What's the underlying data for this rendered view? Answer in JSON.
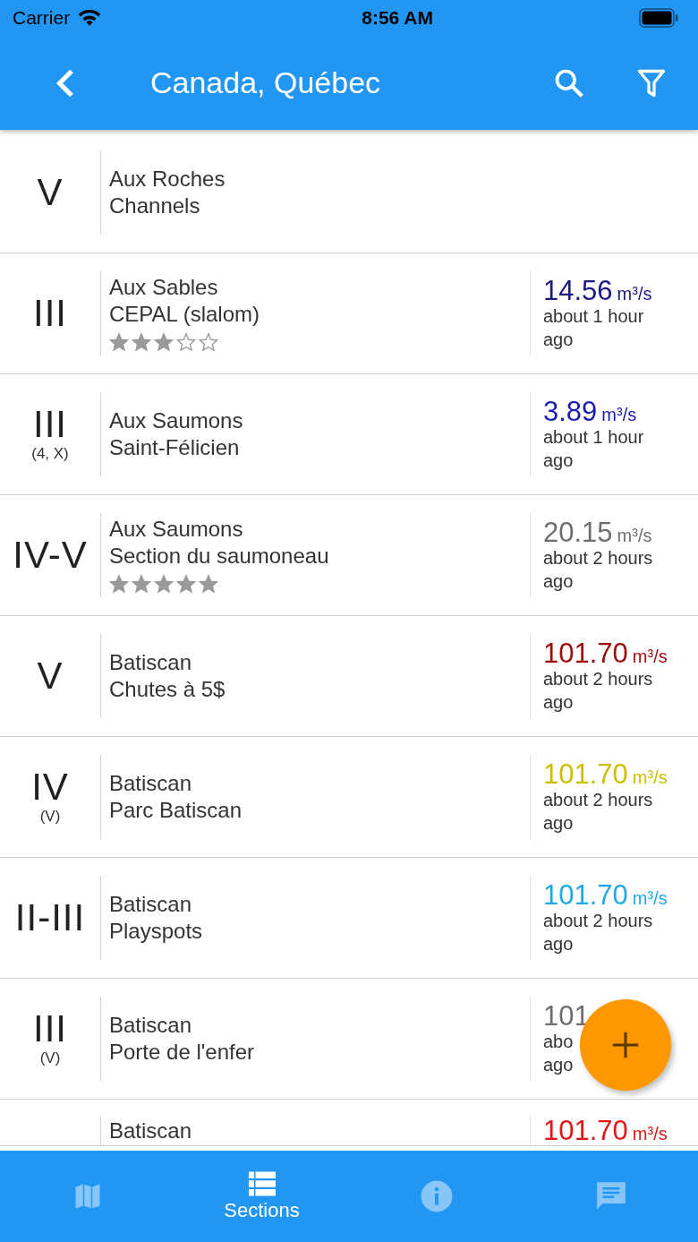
{
  "status_bar": {
    "carrier": "Carrier",
    "time": "8:56 AM"
  },
  "app_bar": {
    "title": "Canada, Québec"
  },
  "sections": [
    {
      "grade": "V",
      "river": "Aux Roches",
      "section": "Channels"
    },
    {
      "grade": "III",
      "river": "Aux Sables",
      "section": "CEPAL (slalom)",
      "stars": 3,
      "flow": "14.56",
      "unit": "m³/s",
      "color": "#1a1a80",
      "time": [
        "about 1 hour",
        "ago"
      ]
    },
    {
      "grade": "III",
      "grade_note": "(4, X)",
      "river": "Aux Saumons",
      "section": "Saint-Félicien",
      "flow": "3.89",
      "unit": "m³/s",
      "color": "#1a1ab4",
      "time": [
        "about 1 hour",
        "ago"
      ]
    },
    {
      "grade": "IV-V",
      "river": "Aux Saumons",
      "section": "Section du saumoneau",
      "stars": 5,
      "flow": "20.15",
      "unit": "m³/s",
      "color": "#6e6e6e",
      "time": [
        "about 2 hours",
        "ago"
      ]
    },
    {
      "grade": "V",
      "river": "Batiscan",
      "section": "Chutes à 5$",
      "flow": "101.70",
      "unit": "m³/s",
      "color": "#9e0b0b",
      "time": [
        "about 2 hours",
        "ago"
      ]
    },
    {
      "grade": "IV",
      "grade_note": "(V)",
      "river": "Batiscan",
      "section": "Parc Batiscan",
      "flow": "101.70",
      "unit": "m³/s",
      "color": "#cdc000",
      "time": [
        "about 2 hours",
        "ago"
      ]
    },
    {
      "grade": "II-III",
      "river": "Batiscan",
      "section": "Playspots",
      "flow": "101.70",
      "unit": "m³/s",
      "color": "#20a8e8",
      "time": [
        "about 2 hours",
        "ago"
      ]
    },
    {
      "grade": "III",
      "grade_note": "(V)",
      "river": "Batiscan",
      "section": "Porte de l'enfer",
      "flow": "101",
      "color": "#6e6e6e",
      "time": [
        "abo",
        "ago"
      ]
    },
    {
      "river": "Batiscan",
      "flow": "101.70",
      "unit": "m³/s",
      "color": "#e81414"
    }
  ],
  "tabs": [
    {
      "selected": false
    },
    {
      "label": "Sections",
      "selected": true
    },
    {
      "selected": false
    },
    {
      "selected": false
    }
  ]
}
